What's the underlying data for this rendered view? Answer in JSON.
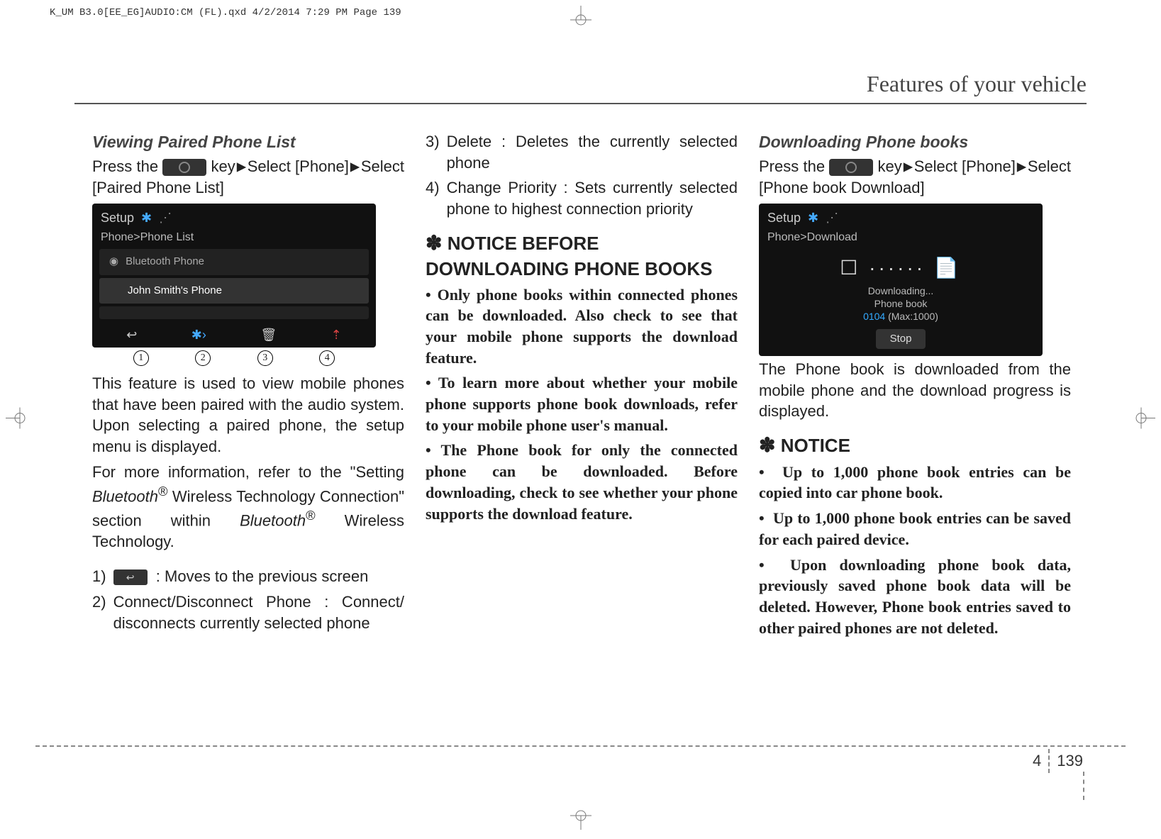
{
  "print_header": "K_UM B3.0[EE_EG]AUDIO:CM (FL).qxd   4/2/2014   7:29 PM   Page 139",
  "page_title": "Features of your vehicle",
  "page_num_section": "4",
  "page_num_page": "139",
  "col1": {
    "heading": "Viewing Paired Phone List",
    "intro_a": "Press the ",
    "intro_b": " key",
    "intro_c": "Select [Phone]",
    "intro_d": "Select [Paired Phone List]",
    "screenshot": {
      "title": "Setup",
      "crumb": "Phone>Phone List",
      "row1": "Bluetooth Phone",
      "row2": "John Smith's Phone"
    },
    "para1": "This feature is used to view mobile phones that have been paired with the audio system. Upon selecting a paired phone, the setup menu is displayed.",
    "para2a": "For more information, refer to the \"Setting ",
    "para2b": "Bluetooth",
    "para2c": "®",
    "para2d": " Wireless Technology Connection\" section within ",
    "para2e": "Bluetooth",
    "para2f": "®",
    "para2g": " Wireless Technology.",
    "item1": ": Moves to the previous screen",
    "item2": "Connect/Disconnect Phone : Connect/ disconnects currently selected phone"
  },
  "col2": {
    "item3": "Delete : Deletes the currently selected phone",
    "item4": "Change Priority : Sets currently selected phone to highest connection priority",
    "notice_head": "NOTICE BEFORE DOWNLOADING PHONE BOOKS",
    "b1": "Only phone books within connected phones can be downloaded. Also check to see that your mobile phone supports the download feature.",
    "b2": "To learn more about whether your mobile phone supports phone book downloads, refer to your mobile phone user's manual.",
    "b3": "The Phone book for only the connected phone can be downloaded. Before downloading, check to see whether your phone supports the download feature."
  },
  "col3": {
    "heading": "Downloading Phone books",
    "intro_a": "Press the ",
    "intro_b": " key",
    "intro_c": "Select [Phone]",
    "intro_d": "Select [Phone book Download]",
    "screenshot": {
      "title": "Setup",
      "crumb": "Phone>Download",
      "line1": "Downloading...",
      "line2": "Phone book",
      "count": "0104",
      "max": " (Max:1000)",
      "stop": "Stop"
    },
    "para1": "The Phone book is downloaded from the mobile phone and the download progress is displayed.",
    "notice_head": "NOTICE",
    "b1": "Up to 1,000 phone book entries can be copied into car phone book.",
    "b2": "Up to 1,000 phone book entries can be saved for each paired device.",
    "b3": "Upon downloading phone book data, previously saved phone book data will be deleted. However, Phone book entries saved to other paired phones are not deleted."
  }
}
